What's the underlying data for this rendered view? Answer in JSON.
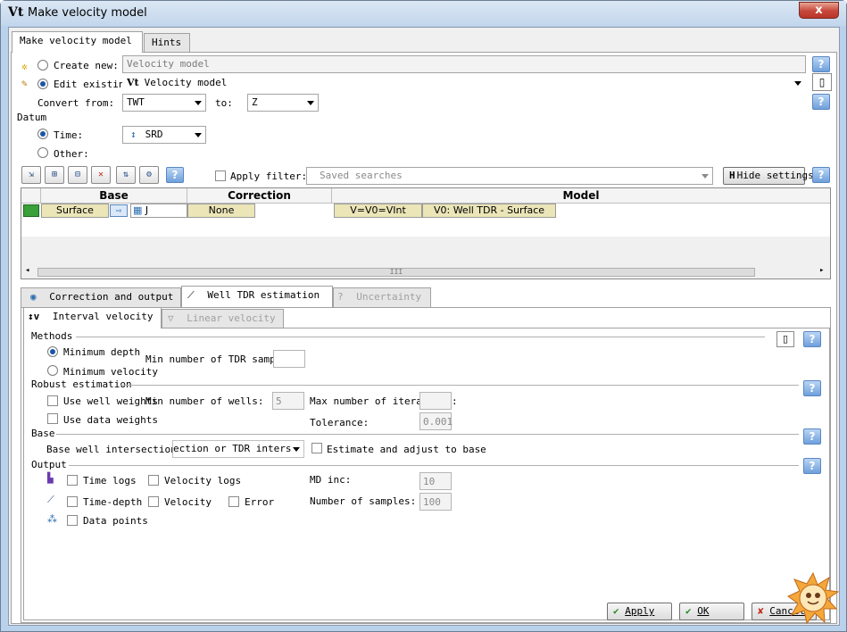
{
  "window": {
    "title": "Make velocity model",
    "close_label": "x",
    "app_icon": "Vt"
  },
  "top_tabs": [
    {
      "label": "Make velocity model"
    },
    {
      "label": "Hints"
    }
  ],
  "create_new": {
    "label": "Create new:",
    "placeholder": "Velocity model"
  },
  "edit_existing": {
    "label": "Edit existing:",
    "value": "Velocity model"
  },
  "convert": {
    "from_label": "Convert from:",
    "from_value": "TWT",
    "to_label": "to:",
    "to_value": "Z"
  },
  "datum": {
    "label": "Datum",
    "time_label": "Time:",
    "time_value": "SRD",
    "other_label": "Other:"
  },
  "filter": {
    "apply_label": "Apply filter:",
    "search_placeholder": "Saved searches",
    "hide_settings": "Hide settings",
    "hide_settings_key": "H"
  },
  "grid": {
    "headers": {
      "base": "Base",
      "correction": "Correction",
      "model": "Model"
    },
    "row": {
      "surface": "Surface",
      "horizon": "J",
      "correction": "None",
      "model_type": "V=V0=VInt",
      "model_v0": "V0: Well TDR - Surface"
    },
    "scroll_mark": "III"
  },
  "mid_tabs": [
    {
      "label": "Correction and output"
    },
    {
      "label": "Well TDR estimation"
    },
    {
      "label": "Uncertainty"
    }
  ],
  "sub_tabs": [
    {
      "label": "Interval velocity"
    },
    {
      "label": "Linear velocity"
    }
  ],
  "methods": {
    "label": "Methods",
    "min_depth": "Minimum depth",
    "min_velocity": "Minimum velocity",
    "min_tdr_label": "Min number of TDR samples:",
    "min_tdr_value": ""
  },
  "robust": {
    "label": "Robust estimation",
    "use_well_weights": "Use well weights",
    "use_data_weights": "Use data weights",
    "min_wells_label": "Min number of wells:",
    "min_wells_value": "5",
    "max_iter_label": "Max number of iterations:",
    "max_iter_value": "",
    "tolerance_label": "Tolerance:",
    "tolerance_value": "0.001"
  },
  "base": {
    "label": "Base",
    "intersection_label": "Base well intersection:",
    "intersection_value": "ection or TDR inters",
    "estimate_label": "Estimate and adjust to base"
  },
  "output": {
    "label": "Output",
    "time_logs": "Time logs",
    "velocity_logs": "Velocity logs",
    "time_depth": "Time-depth",
    "velocity": "Velocity",
    "error": "Error",
    "data_points": "Data points",
    "md_inc_label": "MD inc:",
    "md_inc_value": "10",
    "samples_label": "Number of samples:",
    "samples_value": "100"
  },
  "buttons": {
    "apply": "Apply",
    "ok": "OK",
    "cancel": "Cancel"
  },
  "help_glyph": "?",
  "colors": {
    "accent": "#1a55a8",
    "help": "#6fa0dc",
    "apply_check": "#2a8a2a",
    "cancel_x": "#c0261a",
    "title_bg": "#c2d6ec"
  }
}
